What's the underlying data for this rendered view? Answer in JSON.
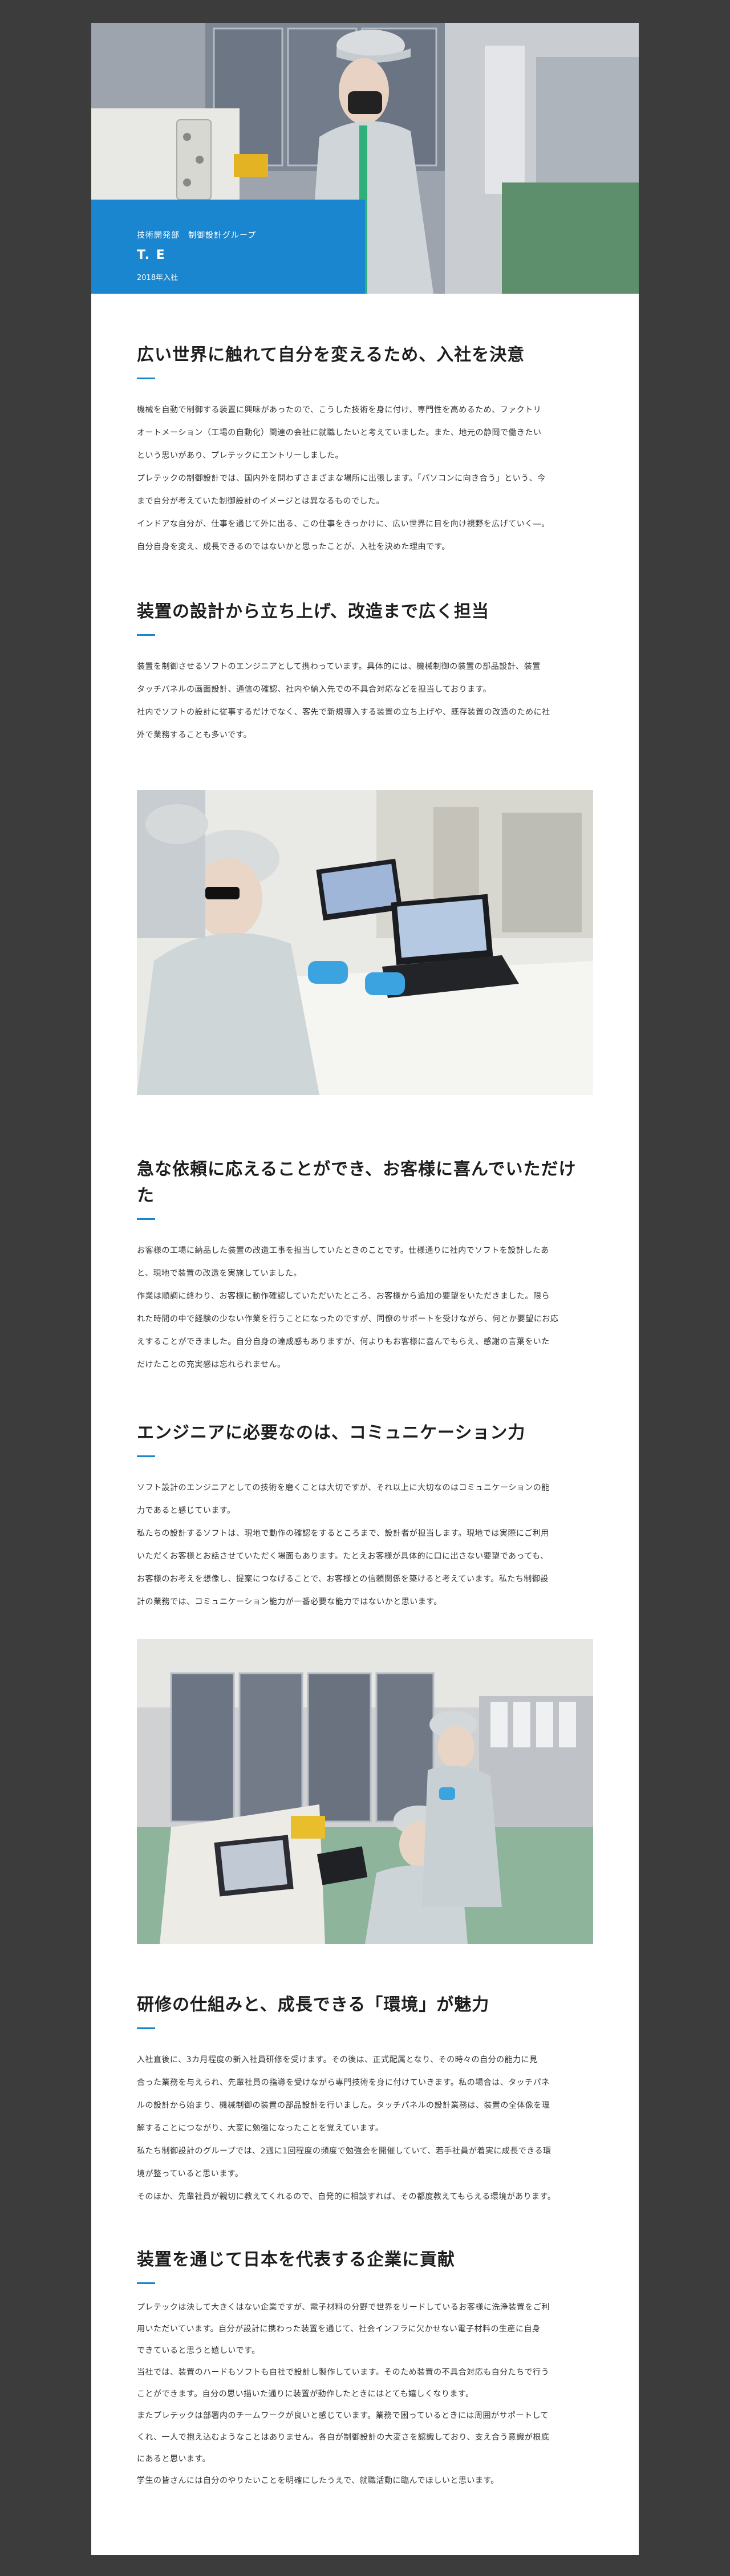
{
  "hero": {
    "department": "技術開発部　制御設計グループ",
    "name": "T. E",
    "joined": "2018年入社"
  },
  "sections": [
    {
      "title": "広い世界に触れて自分を変えるため、入社を決意",
      "paragraphs": [
        "機械を自動で制御する装置に興味があったので、こうした技術を身に付け、専門性を高めるため、ファクトリ",
        "オートメーション（工場の自動化）関連の会社に就職したいと考えていました。また、地元の静岡で働きたい",
        "という思いがあり、プレテックにエントリーしました。",
        "プレテックの制御設計では、国内外を問わずさまざまな場所に出張します。「パソコンに向き合う」という、今",
        "まで自分が考えていた制御設計のイメージとは異なるものでした。",
        "インドアな自分が、仕事を通じて外に出る、この仕事をきっかけに、広い世界に目を向け視野を広げていく―。",
        "自分自身を変え、成長できるのではないかと思ったことが、入社を決めた理由です。"
      ]
    },
    {
      "title": "装置の設計から立ち上げ、改造まで広く担当",
      "paragraphs": [
        "装置を制御させるソフトのエンジニアとして携わっています。具体的には、機械制御の装置の部品設計、装置",
        "タッチパネルの画面設計、通信の確認、社内や納入先での不具合対応などを担当しております。",
        "社内でソフトの設計に従事するだけでなく、客先で新規導入する装置の立ち上げや、既存装置の改造のために社",
        "外で業務することも多いです。"
      ]
    },
    {
      "title": "急な依頼に応えることができ、お客様に喜んでいただけた",
      "paragraphs": [
        "お客様の工場に納品した装置の改造工事を担当していたときのことです。仕様通りに社内でソフトを設計したあ",
        "と、現地で装置の改造を実施していました。",
        "作業は順調に終わり、お客様に動作確認していただいたところ、お客様から追加の要望をいただきました。限ら",
        "れた時間の中で経験の少ない作業を行うことになったのですが、同僚のサポートを受けながら、何とか要望にお応",
        "えすることができました。自分自身の達成感もありますが、何よりもお客様に喜んでもらえ、感謝の言葉をいた",
        "だけたことの充実感は忘れられません。"
      ]
    },
    {
      "title": "エンジニアに必要なのは、コミュニケーション力",
      "paragraphs": [
        "ソフト設計のエンジニアとしての技術を磨くことは大切ですが、それ以上に大切なのはコミュニケーションの能",
        "力であると感じています。",
        "私たちの設計するソフトは、現地で動作の確認をするところまで、設計者が担当します。現地では実際にご利用",
        "いただくお客様とお話させていただく場面もあります。たとえお客様が具体的に口に出さない要望であっても、",
        "お客様のお考えを想像し、提案につなげることで、お客様との信頼関係を築けると考えています。私たち制御設",
        "計の業務では、コミュニケーション能力が一番必要な能力ではないかと思います。"
      ]
    },
    {
      "title": "研修の仕組みと、成長できる「環境」が魅力",
      "paragraphs": [
        "入社直後に、3カ月程度の新入社員研修を受けます。その後は、正式配属となり、その時々の自分の能力に見",
        "合った業務を与えられ、先輩社員の指導を受けながら専門技術を身に付けていきます。私の場合は、タッチパネ",
        "ルの設計から始まり、機械制御の装置の部品設計を行いました。タッチパネルの設計業務は、装置の全体像を理",
        "解することにつながり、大変に勉強になったことを覚えています。",
        "私たち制御設計のグループでは、2週に1回程度の頻度で勉強会を開催していて、若手社員が着実に成長できる環",
        "境が整っていると思います。",
        "そのほか、先輩社員が親切に教えてくれるので、自発的に相談すれば、その都度教えてもらえる環境があります。"
      ]
    },
    {
      "title": "装置を通じて日本を代表する企業に貢献",
      "paragraphs": [
        "プレテックは決して大きくはない企業ですが、電子材料の分野で世界をリードしているお客様に洗浄装置をご利",
        "用いただいています。自分が設計に携わった装置を通じて、社会インフラに欠かせない電子材料の生産に自身",
        "できていると思うと嬉しいです。",
        "当社では、装置のハードもソフトも自社で設計し製作しています。そのため装置の不具合対応も自分たちで行う",
        "ことができます。自分の思い描いた通りに装置が動作したときにはとても嬉しくなります。",
        "またプレテックは部署内のチームワークが良いと感じています。業務で困っているときには周囲がサポートして",
        "くれ、一人で抱え込むようなことはありません。各自が制御設計の大変さを認識しており、支え合う意識が根底",
        "にあると思います。",
        "学生の皆さんには自分のやりたいことを明確にしたうえで、就職活動に臨んでほしいと思います。"
      ]
    }
  ],
  "colors": {
    "accent": "#1a86cf",
    "backdrop": "#3c3c3c"
  }
}
